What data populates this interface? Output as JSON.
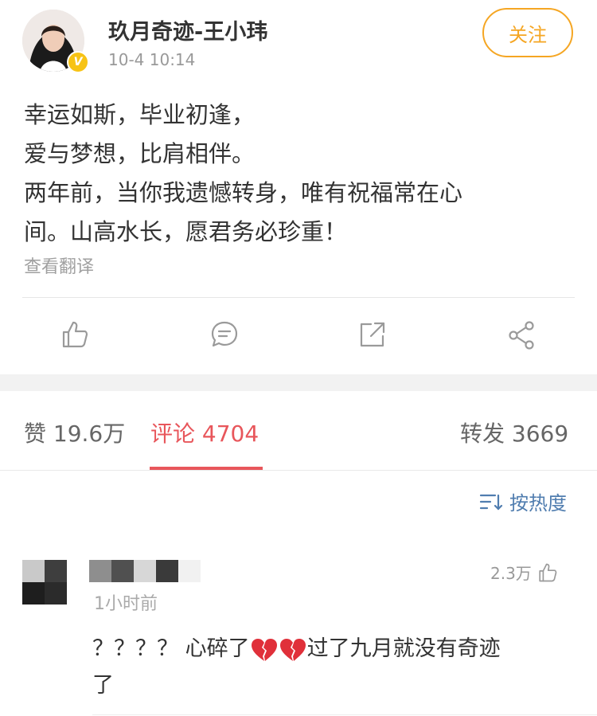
{
  "post": {
    "username": "玖月奇迹-王小玮",
    "time": "10-4 10:14",
    "follow_label": "关注",
    "verified_badge": "V",
    "content_lines": [
      "幸运如斯，毕业初逢，",
      "爱与梦想，比肩相伴。",
      "两年前，当你我遗憾转身，唯有祝福常在心",
      "间。山高水长，愿君务必珍重！"
    ],
    "translate_label": "查看翻译"
  },
  "actions": [
    "like-icon",
    "comment-icon",
    "repost-icon",
    "share-icon"
  ],
  "stats": {
    "likes": "赞 19.6万",
    "comments": "评论 4704",
    "reposts": "转发 3669"
  },
  "sort": {
    "label": "按热度"
  },
  "comment": {
    "time": "1小时前",
    "likes": "2.3万",
    "text_prefix": "？？？？ 心碎了",
    "text_suffix": "过了九月就没有奇迹",
    "text_line2": "了"
  },
  "colors": {
    "accent_red": "#e8565b",
    "follow_orange": "#f5a623",
    "link_blue": "#507daf",
    "verified_yellow": "#f7c315"
  }
}
